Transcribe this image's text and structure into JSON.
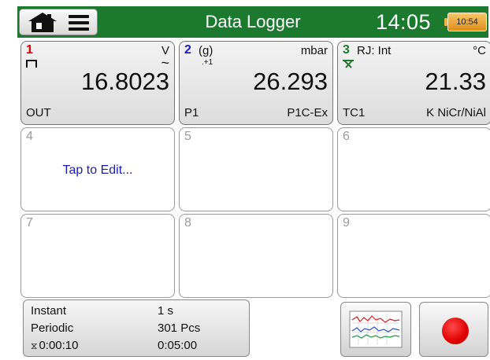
{
  "header": {
    "title": "Data Logger",
    "clock": "14:05",
    "battery_label": "10:54",
    "home_icon": "home-icon",
    "menu_icon": "hamburger-menu-icon",
    "background_color": "#1c7a2f"
  },
  "channels": [
    {
      "number": "1",
      "number_color": "#e00000",
      "unit": "V",
      "signal_icon": "tilde-ac-icon",
      "value": "16.8023",
      "bottom_left": "OUT",
      "icon": "pulse-output-icon"
    },
    {
      "number": "2",
      "number_color": "#1a1ad0",
      "subtitle": "(g)",
      "extra": ".+1",
      "unit": "mbar",
      "value": "26.293",
      "bottom_left": "P1",
      "bottom_right": "P1C-Ex"
    },
    {
      "number": "3",
      "number_color": "#1c7a2f",
      "subtitle": "RJ: Int",
      "unit": "°C",
      "value": "21.33",
      "bottom_left": "TC1",
      "bottom_right": "K  NiCr/NiAl",
      "icon": "thermocouple-icon"
    },
    {
      "number": "4",
      "edit_label": "Tap to Edit..."
    },
    {
      "number": "5"
    },
    {
      "number": "6"
    },
    {
      "number": "7"
    },
    {
      "number": "8"
    },
    {
      "number": "9"
    }
  ],
  "logging": {
    "mode_label": "Instant",
    "mode_value": "1 s",
    "type_label": "Periodic",
    "type_value": "301 Pcs",
    "elapsed": "0:00:10",
    "total": "0:05:00"
  },
  "buttons": {
    "graph_icon": "graph-view-icon",
    "record_icon": "record-icon",
    "record_color": "#e00000"
  }
}
